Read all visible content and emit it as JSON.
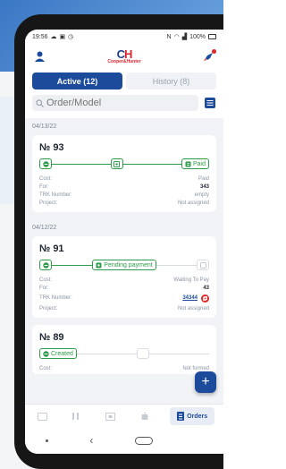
{
  "status_bar": {
    "time": "19:56",
    "battery": "100%"
  },
  "brand": {
    "logo_mark_c": "C",
    "logo_mark_h": "H",
    "logo_text": "Cooper&Hunter"
  },
  "tabs": [
    {
      "label": "Active (12)",
      "active": true
    },
    {
      "label": "History (8)",
      "active": false
    }
  ],
  "search": {
    "placeholder": "Order/Model"
  },
  "groups": [
    {
      "date": "04/13/22",
      "order": {
        "title": "№ 93",
        "progress": {
          "final_label": "Paid"
        },
        "cost_label": "Cost:",
        "cost_value": "Paid",
        "for_label": "For:",
        "for_value": "343",
        "trk_label": "TRK Number:",
        "trk_value": "empty",
        "project_label": "Project:",
        "project_value": "Not assigned"
      }
    },
    {
      "date": "04/12/22",
      "order": {
        "title": "№ 91",
        "progress": {
          "current_label": "Pending payment"
        },
        "cost_label": "Cost:",
        "cost_value": "Waiting To Pay",
        "for_label": "For:",
        "for_value": "43",
        "trk_label": "TRK Number:",
        "trk_value": "34344",
        "project_label": "Project:",
        "project_value": "Not assigned"
      }
    },
    {
      "date": "",
      "order": {
        "title": "№ 89",
        "progress": {
          "current_label": "Created"
        },
        "cost_label": "Cost:",
        "cost_value": "Not formed"
      }
    }
  ],
  "bottom_nav": {
    "orders_label": "Orders"
  },
  "colors": {
    "primary": "#1d4b9c",
    "success": "#2e9c4a",
    "danger": "#e02626"
  }
}
